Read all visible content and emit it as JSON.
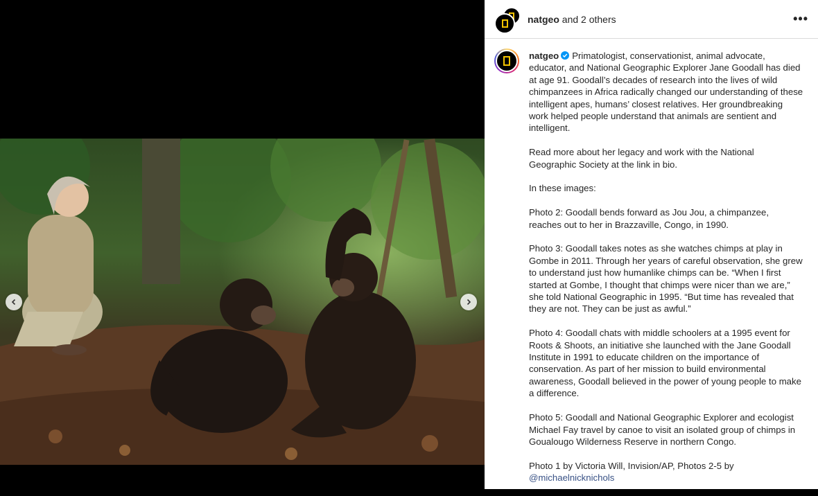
{
  "header": {
    "username": "natgeo",
    "suffix": "and 2 others",
    "more_label": "•••"
  },
  "caption": {
    "username": "natgeo",
    "verified_icon": "verified-badge-icon",
    "intro": "Primatologist, conservationist, animal advocate, educator, and National Geographic Explorer Jane Goodall has died at age 91. Goodall’s decades of research into the lives of wild chimpanzees in Africa radically changed our understanding of these intelligent apes, humans’ closest relatives. Her groundbreaking work helped people understand that animals are sentient and intelligent.",
    "read_more": "Read more about her legacy and work with the National Geographic Society at the link in bio.",
    "in_images": "In these images:",
    "photo2": "Photo 2: Goodall bends forward as Jou Jou, a chimpanzee, reaches out to her in Brazzaville, Congo, in 1990.",
    "photo3": "Photo 3: Goodall takes notes as she watches chimps at play in Gombe in 2011. Through her years of careful observation, she grew to understand just how humanlike chimps can be. “When I first started at Gombe, I thought that chimps were nicer than we are,” she told National Geographic in 1995. “But time has revealed that they are not. They can be just as awful.”",
    "photo4": "Photo 4: Goodall chats with middle schoolers at a 1995 event for Roots & Shoots, an initiative she launched with the Jane Goodall Institute in 1991 to educate children on the importance of conservation. As part of her mission to build environmental awareness, Goodall believed in the power of young people to make a difference.",
    "photo5": "Photo 5: Goodall and National Geographic Explorer and ecologist Michael Fay travel by canoe to visit an isolated group of chimps in Goualougo Wilderness Reserve in northern Congo.",
    "credit": "Photo 1 by Victoria Will, Invision/AP, Photos 2-5 by",
    "credit_mention": "@michaelnicknichols"
  },
  "carousel": {
    "prev_icon": "chevron-left-icon",
    "next_icon": "chevron-right-icon"
  },
  "colors": {
    "accent_blue": "#0095f6",
    "natgeo_yellow": "#f5c400",
    "mention": "#385185"
  }
}
